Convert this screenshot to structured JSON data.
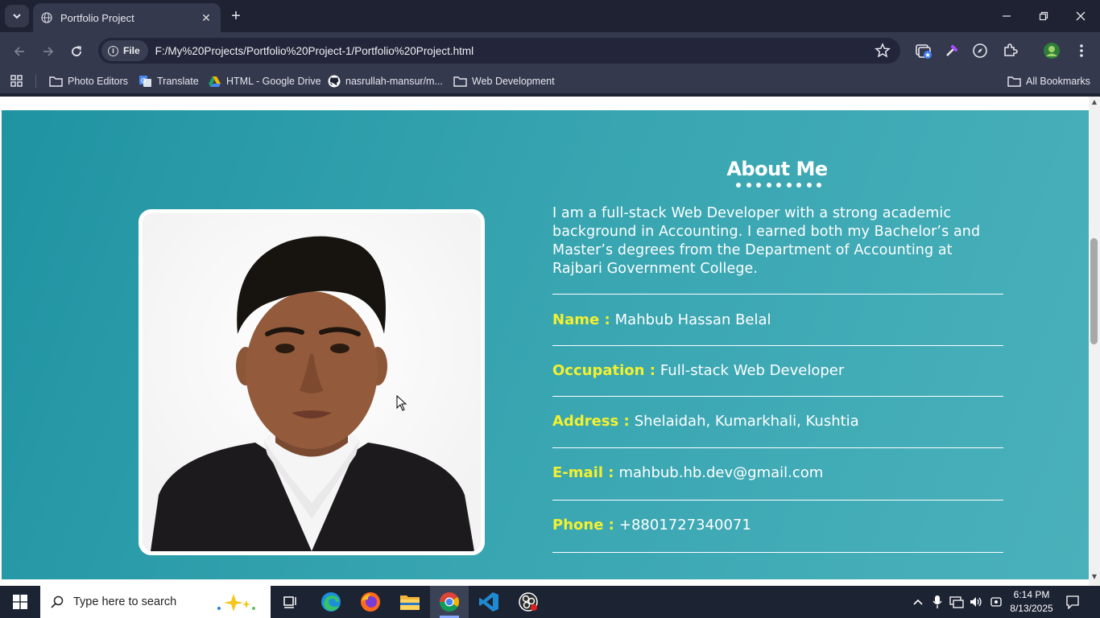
{
  "browser": {
    "tab_title": "Portfolio Project",
    "new_tab_symbol": "+",
    "site_chip": "File",
    "url": "F:/My%20Projects/Portfolio%20Project-1/Portfolio%20Project.html",
    "bookmarks": [
      {
        "label": "Photo Editors",
        "icon": "folder-icon"
      },
      {
        "label": "Translate",
        "icon": "translate-icon"
      },
      {
        "label": "HTML - Google Drive",
        "icon": "google-drive-icon"
      },
      {
        "label": "nasrullah-mansur/m...",
        "icon": "github-icon"
      },
      {
        "label": "Web Development",
        "icon": "folder-icon"
      }
    ],
    "all_bookmarks": "All Bookmarks"
  },
  "about": {
    "title": "About Me",
    "description": "I am a full-stack Web Developer with a strong academic background in Accounting. I earned both my Bachelor’s and Master’s degrees from the Department of Accounting at Rajbari Government College.",
    "info": [
      {
        "label": "Name :",
        "value": "Mahbub Hassan Belal"
      },
      {
        "label": "Occupation :",
        "value": "Full-stack Web Developer"
      },
      {
        "label": "Address :",
        "value": "Shelaidah, Kumarkhali, Kushtia"
      },
      {
        "label": "E-mail :",
        "value": "mahbub.hb.dev@gmail.com"
      },
      {
        "label": "Phone :",
        "value": "+8801727340071"
      }
    ],
    "colors": {
      "accent_label": "#f4f02e",
      "background": "#36a4b0"
    }
  },
  "taskbar": {
    "search_placeholder": "Type here to search",
    "time": "6:14 PM",
    "date": "8/13/2025"
  }
}
